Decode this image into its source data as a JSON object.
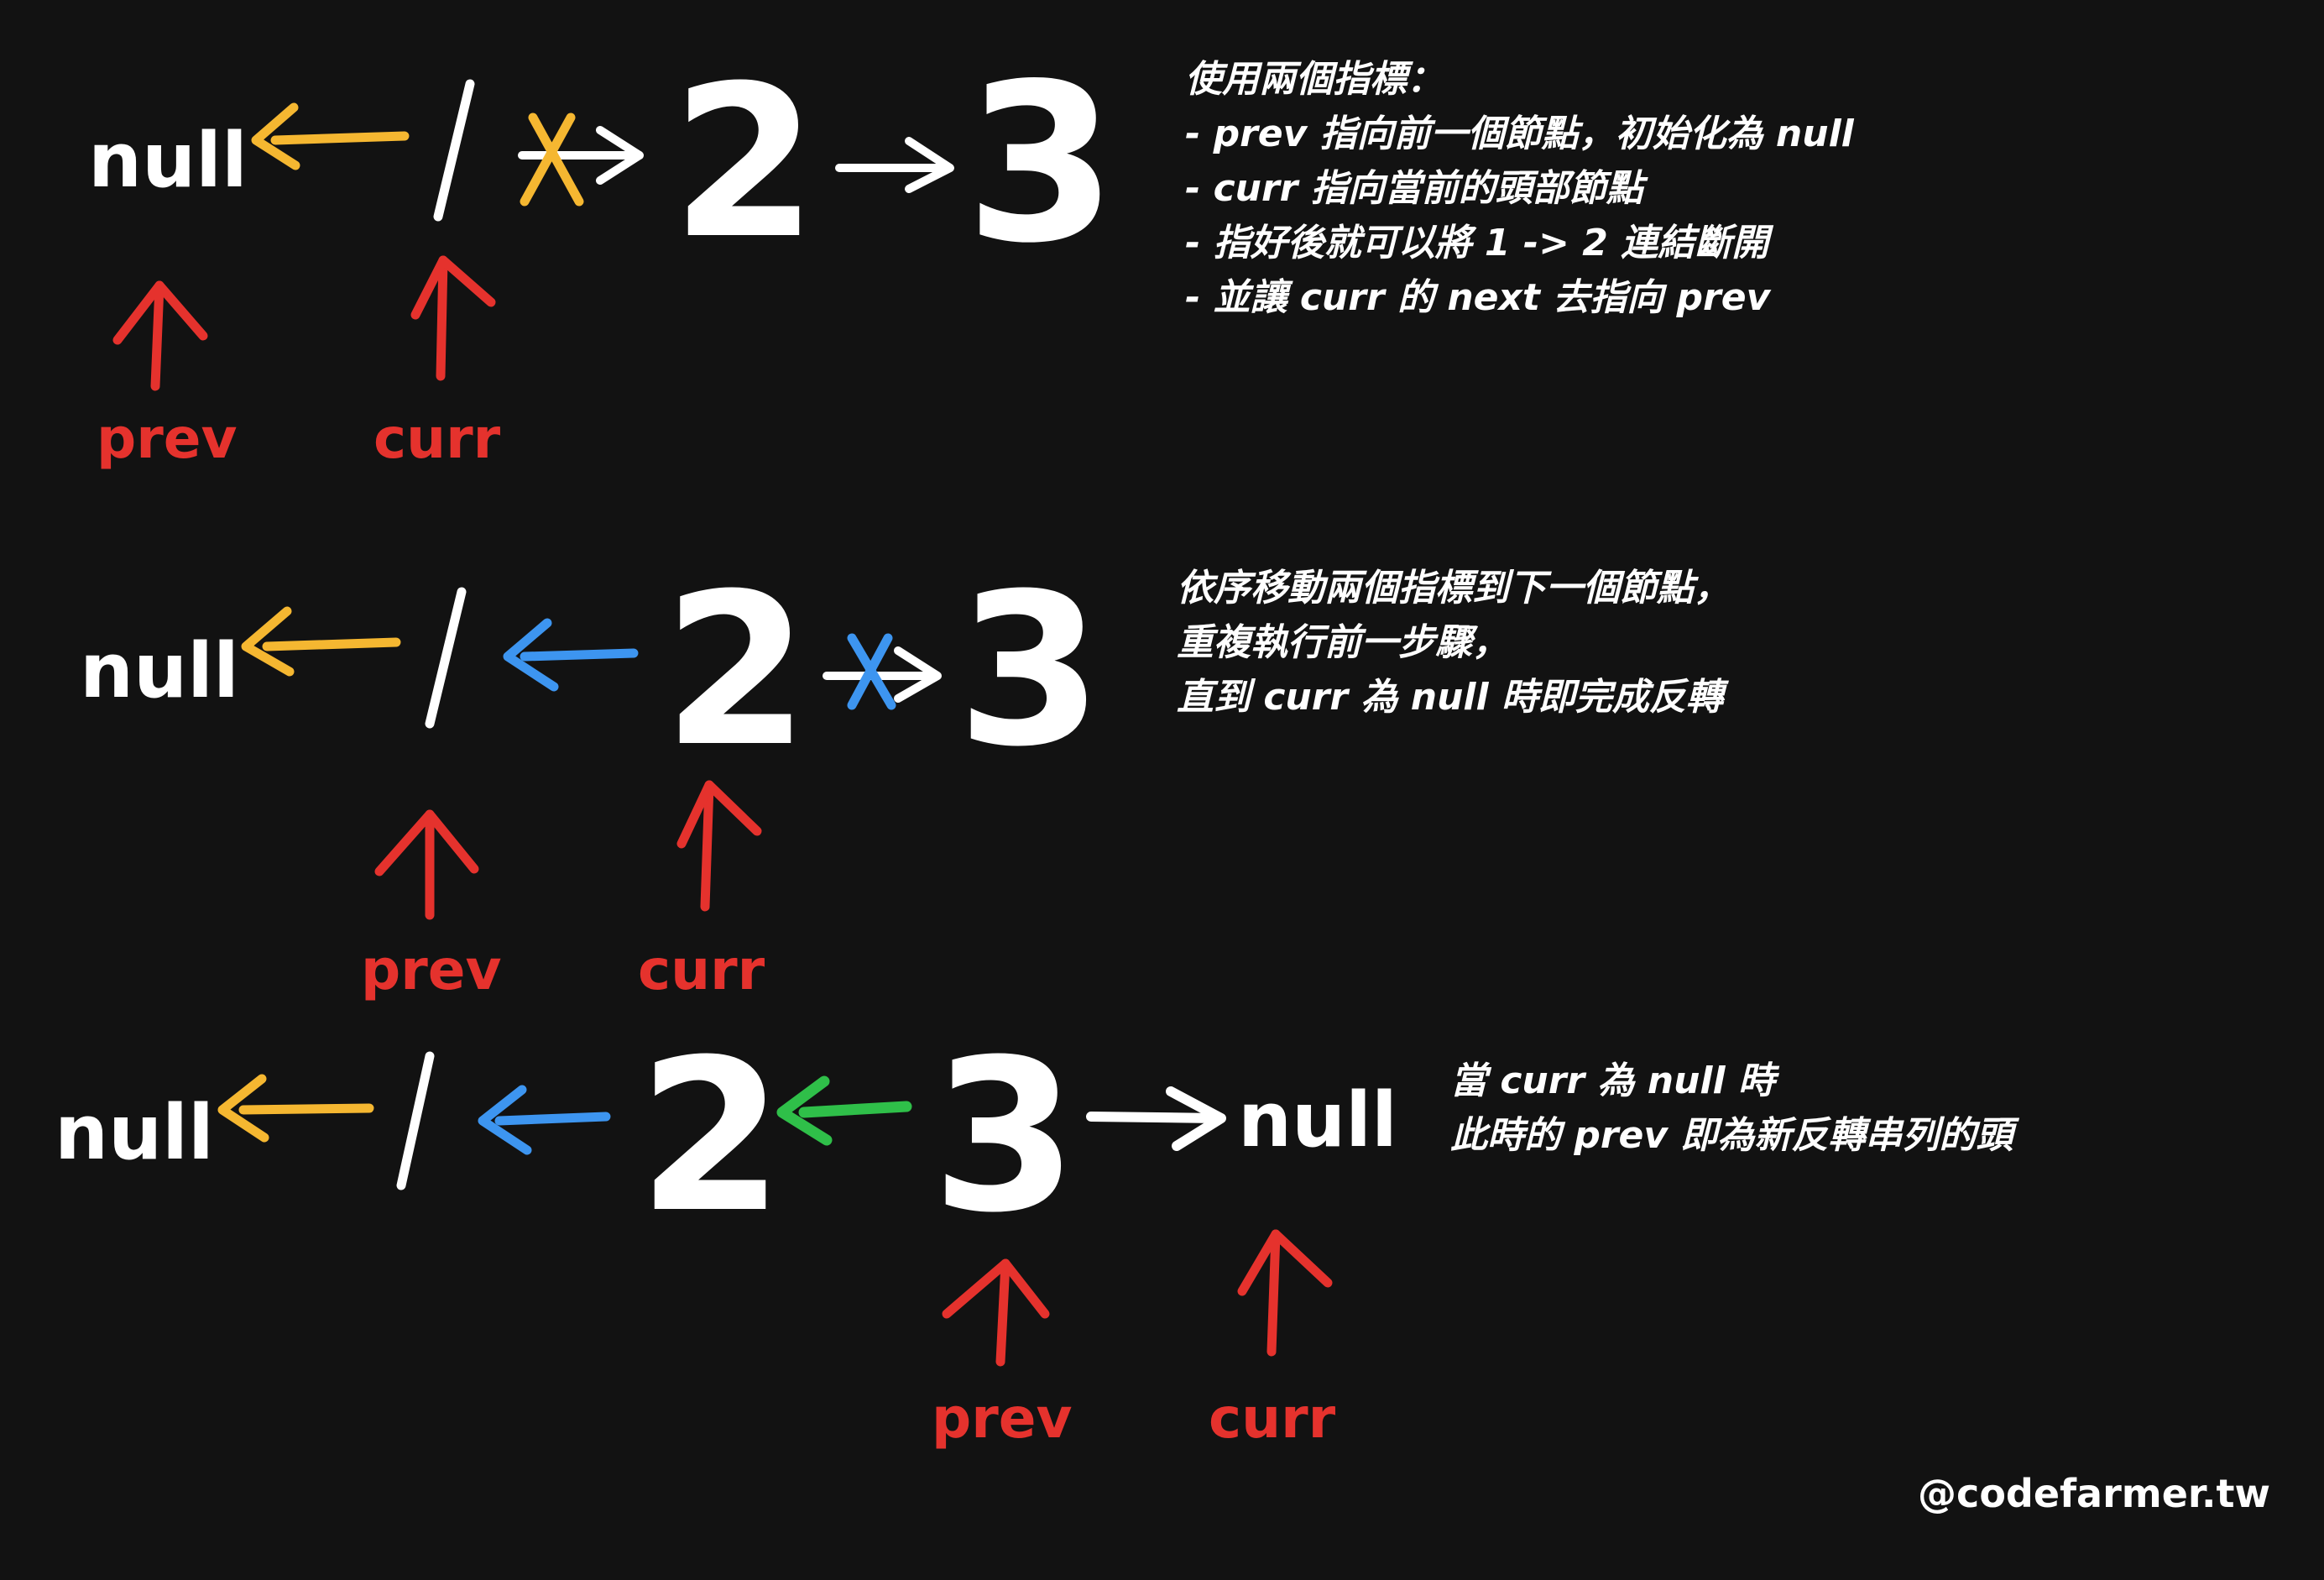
{
  "colors": {
    "background": "#121212",
    "node": "#ffffff",
    "pointer": "#e5322d",
    "link_to_null": "#f5b731",
    "link_1_2": "#3d95f0",
    "link_2_3": "#2fbf49",
    "forward_link": "#ffffff"
  },
  "diagram": {
    "step1": {
      "null_left": "null",
      "nodes": [
        "1",
        "2",
        "3"
      ],
      "prev_label": "prev",
      "curr_label": "curr"
    },
    "step2": {
      "null_left": "null",
      "nodes": [
        "1",
        "2",
        "3"
      ],
      "prev_label": "prev",
      "curr_label": "curr"
    },
    "step3": {
      "null_left": "null",
      "nodes": [
        "1",
        "2",
        "3"
      ],
      "null_right": "null",
      "prev_label": "prev",
      "curr_label": "curr"
    }
  },
  "notes": {
    "step1": [
      "使用兩個指標：",
      "- prev 指向前一個節點，初始化為 null",
      "- curr 指向當前的頭部節點",
      "- 指好後就可以將 1 -> 2 連結斷開",
      "- 並讓 curr 的 next 去指向 prev"
    ],
    "step2": [
      "依序移動兩個指標到下一個節點，",
      "重複執行前一步驟，",
      "直到 curr 為 null 時即完成反轉"
    ],
    "step3": [
      "當 curr 為 null 時",
      "此時的 prev 即為新反轉串列的頭"
    ]
  },
  "watermark": "@codefarmer.tw"
}
